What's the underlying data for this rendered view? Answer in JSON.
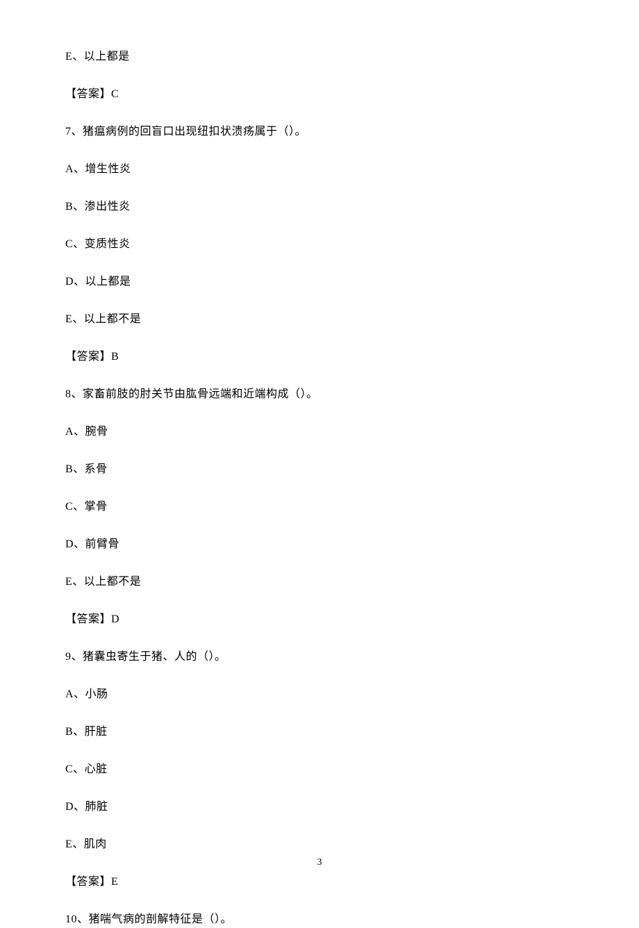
{
  "lines": [
    "E、以上都是",
    "【答案】C",
    "7、猪瘟病例的回盲口出现纽扣状溃疡属于（）。",
    "A、增生性炎",
    "B、渗出性炎",
    "C、变质性炎",
    "D、以上都是",
    "E、以上都不是",
    "【答案】B",
    "8、家畜前肢的肘关节由肱骨远端和近端构成（）。",
    "A、腕骨",
    "B、系骨",
    "C、掌骨",
    "D、前臂骨",
    "E、以上都不是",
    "【答案】D",
    "9、猪囊虫寄生于猪、人的（）。",
    "A、小肠",
    "B、肝脏",
    "C、心脏",
    "D、肺脏",
    "E、肌肉",
    "【答案】E",
    "10、猪喘气病的剖解特征是（）。"
  ],
  "pageNumber": "3"
}
